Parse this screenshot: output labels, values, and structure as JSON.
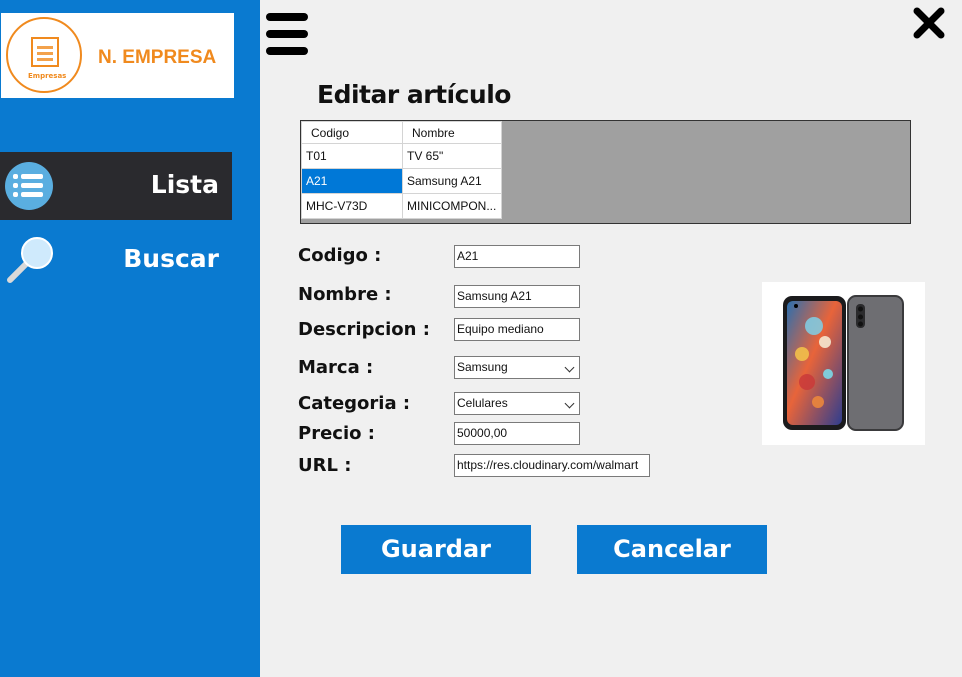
{
  "company": {
    "name": "N. EMPRESA",
    "logo_caption": "Empresas",
    "brand_color": "#f08a1e"
  },
  "sidebar": {
    "color": "#0a7ad0",
    "items": [
      {
        "label": "Lista",
        "icon": "list-icon",
        "active": true
      },
      {
        "label": "Buscar",
        "icon": "magnifier-icon",
        "active": false
      }
    ]
  },
  "header": {
    "menu_icon": "hamburger-icon",
    "close_icon": "close-icon"
  },
  "page": {
    "title": "Editar artículo"
  },
  "grid": {
    "columns": [
      "Codigo",
      "Nombre"
    ],
    "rows": [
      [
        "T01",
        "TV 65\""
      ],
      [
        "A21",
        "Samsung A21"
      ],
      [
        "MHC-V73D",
        "MINICOMPON..."
      ]
    ],
    "selected_row": 1
  },
  "form": {
    "codigo": {
      "label": "Codigo :",
      "value": "A21"
    },
    "nombre": {
      "label": "Nombre :",
      "value": "Samsung A21"
    },
    "descripcion": {
      "label": "Descripcion :",
      "value": "Equipo mediano"
    },
    "marca": {
      "label": "Marca :",
      "value": "Samsung"
    },
    "categoria": {
      "label": "Categoria :",
      "value": "Celulares"
    },
    "precio": {
      "label": "Precio :",
      "value": "50000,00"
    },
    "url": {
      "label": "URL :",
      "value": "https://res.cloudinary.com/walmart"
    }
  },
  "image": {
    "icon": "product-phone-image"
  },
  "buttons": {
    "save": "Guardar",
    "cancel": "Cancelar"
  }
}
